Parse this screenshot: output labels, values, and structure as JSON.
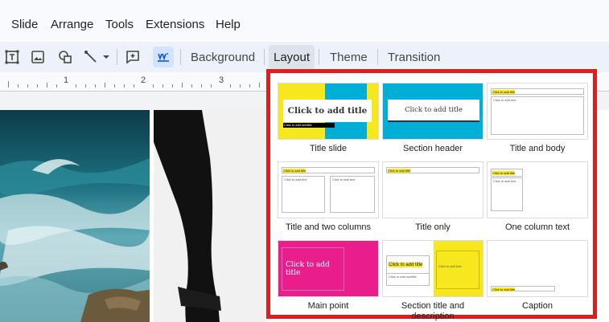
{
  "menu": {
    "slide": "Slide",
    "arrange": "Arrange",
    "tools": "Tools",
    "extensions": "Extensions",
    "help": "Help"
  },
  "toolbar": {
    "background": "Background",
    "layout": "Layout",
    "theme": "Theme",
    "transition": "Transition"
  },
  "ruler": {
    "marks": [
      "1",
      "2",
      "3"
    ]
  },
  "layouts": {
    "title_slide": {
      "label": "Title slide",
      "title": "Click to add title",
      "subtitle": "Click to add subtitle"
    },
    "section_header": {
      "label": "Section header",
      "title": "Click to add title"
    },
    "title_and_body": {
      "label": "Title and body",
      "title": "Click to add title",
      "body": "Click to add text"
    },
    "title_two_columns": {
      "label": "Title and two columns",
      "title": "Click to add title",
      "col1": "Click to add text",
      "col2": "Click to add text"
    },
    "title_only": {
      "label": "Title only",
      "title": "Click to add title"
    },
    "one_column_text": {
      "label": "One column text",
      "title": "Click to add title",
      "body": "Click to add text"
    },
    "main_point": {
      "label": "Main point",
      "title": "Click to add title"
    },
    "section_title_desc": {
      "label": "Section title and description",
      "title": "Click to add title",
      "subtitle": "Click to add subtitle",
      "body": "Click to add text"
    },
    "caption": {
      "label": "Caption",
      "title": "Click to add title"
    }
  },
  "colors": {
    "highlight_border": "#e21b1b",
    "yellow": "#f6e71f",
    "teal": "#00aed6",
    "magenta": "#e91e8c"
  }
}
